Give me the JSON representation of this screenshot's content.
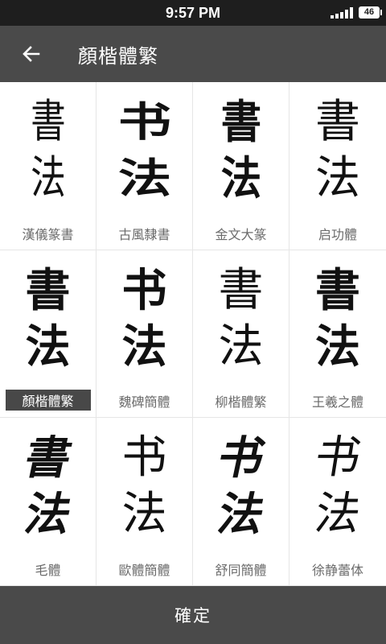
{
  "status_bar": {
    "time": "9:57 PM",
    "battery": "46"
  },
  "header": {
    "title": "顏楷體繁"
  },
  "preview_text": {
    "line1": "書",
    "line2": "法",
    "line1_simplified": "书"
  },
  "fonts": [
    {
      "label": "漢儀篆書",
      "selected": false
    },
    {
      "label": "古風隸書",
      "selected": false
    },
    {
      "label": "金文大篆",
      "selected": false
    },
    {
      "label": "启功體",
      "selected": false
    },
    {
      "label": "顏楷體繁",
      "selected": true
    },
    {
      "label": "魏碑簡體",
      "selected": false
    },
    {
      "label": "柳楷體繁",
      "selected": false
    },
    {
      "label": "王羲之體",
      "selected": false
    },
    {
      "label": "毛體",
      "selected": false
    },
    {
      "label": "歐體簡體",
      "selected": false
    },
    {
      "label": "舒同簡體",
      "selected": false
    },
    {
      "label": "徐静蕾体",
      "selected": false
    }
  ],
  "confirm_button": {
    "label": "確定"
  },
  "colors": {
    "header_bg": "#4a4a4a",
    "status_bg": "#1e1e1e",
    "selected_label_bg": "#484848"
  }
}
